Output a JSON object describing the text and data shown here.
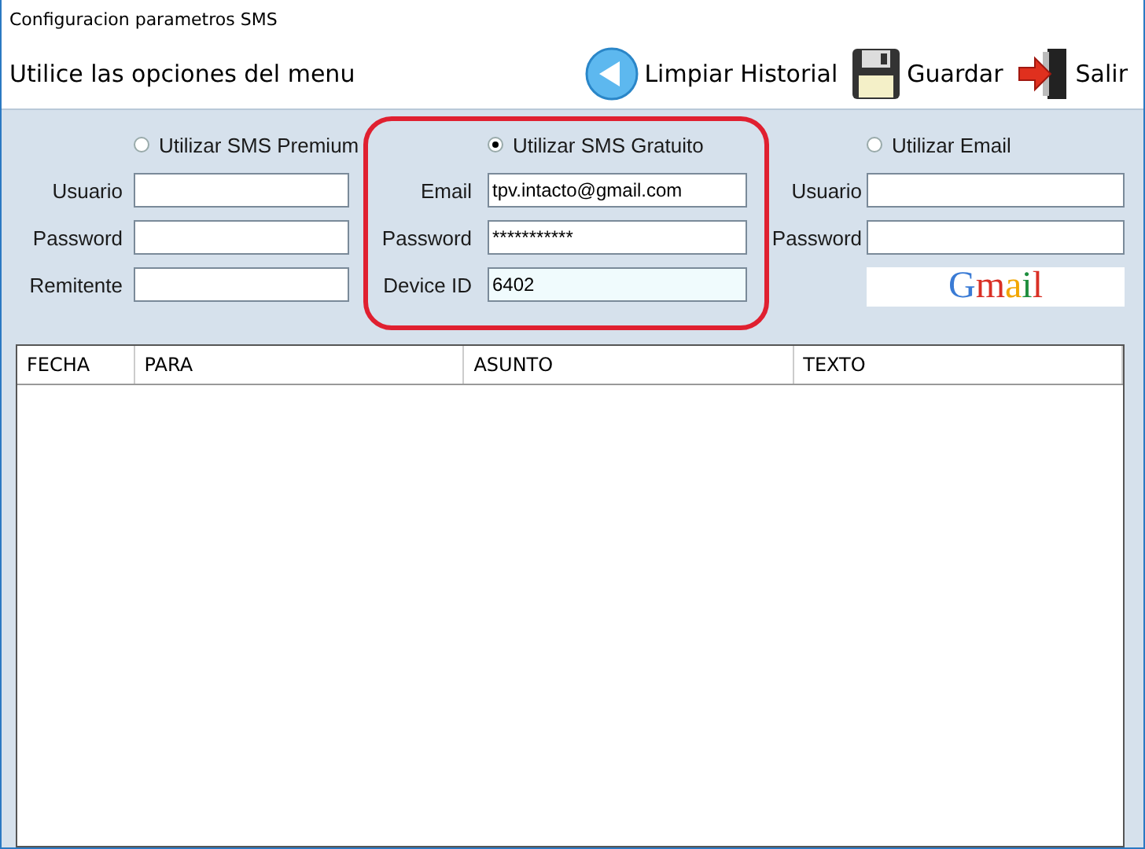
{
  "window": {
    "title": "Configuracion parametros SMS"
  },
  "header": {
    "hint": "Utilice las opciones del menu",
    "actions": [
      {
        "kind": "back",
        "label": "Limpiar Historial"
      },
      {
        "kind": "save",
        "label": "Guardar"
      },
      {
        "kind": "exit",
        "label": "Salir"
      }
    ]
  },
  "options": [
    {
      "radio": {
        "label": "Utilizar SMS Premium",
        "selected": false
      },
      "fields": [
        {
          "label": "Usuario",
          "focused": false
        },
        {
          "label": "Password",
          "focused": false
        },
        {
          "label": "Remitente",
          "focused": false
        }
      ]
    },
    {
      "radio": {
        "label": "Utilizar SMS Gratuito",
        "selected": true
      },
      "fields": [
        {
          "label": "Email",
          "value": "tpv.intacto@gmail.com",
          "focused": false
        },
        {
          "label": "Password",
          "value": "***********",
          "focused": false
        },
        {
          "label": "Device ID",
          "value": "6402",
          "focused": true
        }
      ]
    },
    {
      "radio": {
        "label": "Utilizar Email",
        "selected": false
      },
      "fields": [
        {
          "label": "Usuario",
          "focused": false
        },
        {
          "label": "Password",
          "focused": false
        }
      ],
      "gmail_button": {
        "label": "Gmail"
      }
    }
  ],
  "table": {
    "columns": [
      "FECHA",
      "PARA",
      "ASUNTO",
      "TEXTO"
    ]
  }
}
